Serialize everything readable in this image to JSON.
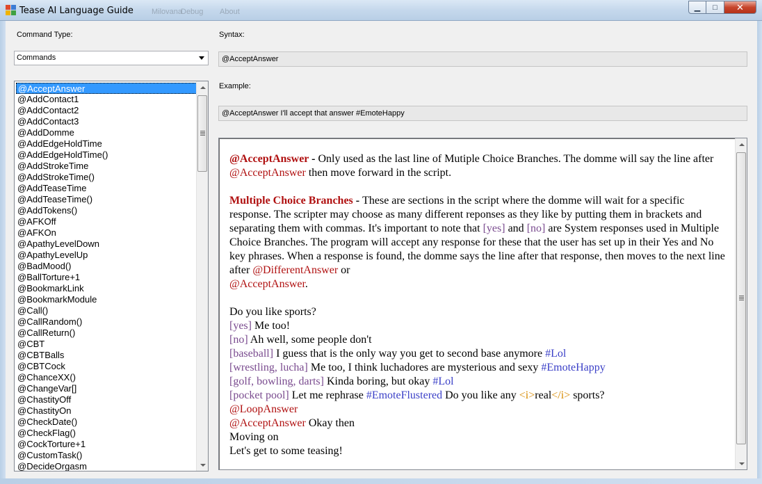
{
  "window": {
    "title": "Tease AI Language Guide",
    "ghost_menu": [
      "",
      "Milovana",
      "Debug",
      "About"
    ],
    "buttons": {
      "minimize": "▁",
      "maximize": "□",
      "close": "✕"
    }
  },
  "left_panel": {
    "command_type_label": "Command Type:",
    "command_type_value": "Commands",
    "commands": [
      "@AcceptAnswer",
      "@AddContact1",
      "@AddContact2",
      "@AddContact3",
      "@AddDomme",
      "@AddEdgeHoldTime",
      "@AddEdgeHoldTime()",
      "@AddStrokeTime",
      "@AddStrokeTime()",
      "@AddTeaseTime",
      "@AddTeaseTime()",
      "@AddTokens()",
      "@AFKOff",
      "@AFKOn",
      "@ApathyLevelDown",
      "@ApathyLevelUp",
      "@BadMood()",
      "@BallTorture+1",
      "@BookmarkLink",
      "@BookmarkModule",
      "@Call()",
      "@CallRandom()",
      "@CallReturn()",
      "@CBT",
      "@CBTBalls",
      "@CBTCock",
      "@ChanceXX()",
      "@ChangeVar[]",
      "@ChastityOff",
      "@ChastityOn",
      "@CheckDate()",
      "@CheckFlag()",
      "@CockTorture+1",
      "@CustomTask()",
      "@DecideOrgasm"
    ],
    "selected_index": 0
  },
  "right_panel": {
    "syntax_label": "Syntax:",
    "syntax_value": "@AcceptAnswer",
    "example_label": "Example:",
    "example_value": "@AcceptAnswer I'll accept that answer #EmoteHappy"
  },
  "description": {
    "p1": {
      "term": "@AcceptAnswer",
      "dash": " - ",
      "text_a": "Only used as the last line of Mutiple Choice Branches. The domme will say the line after ",
      "ref": "@AcceptAnswer",
      "text_b": " then move forward in the script."
    },
    "p2": {
      "term": "Multiple Choice Branches",
      "dash": " - ",
      "text_a": "These are sections in the script where the domme will wait for a specific response. The scripter may choose as many different reponses as they like by putting them in brackets and separating them with commas. It's important to note that ",
      "yes": "[yes]",
      "and": " and ",
      "no": "[no]",
      "text_b": " are System responses used in Multiple Choice Branches. The program will accept any response for these that the user has set up in their Yes and No key phrases. When a response is found, the domme says the line after that response, then moves to the next line after ",
      "ref1": "@DifferentAnswer",
      "or": " or",
      "ref2": "@AcceptAnswer",
      "end": "."
    },
    "example": {
      "q": "Do you like sports?",
      "l1_tag": "[yes]",
      "l1_text": " Me too!",
      "l2_tag": "[no]",
      "l2_text": " Ah well, some people don't",
      "l3_tag": "[baseball]",
      "l3_text": " I guess that is the only way you get to second base anymore ",
      "l3_emote": "#Lol",
      "l4_tag": "[wrestling, lucha]",
      "l4_text": " Me too, I think luchadores are mysterious and sexy ",
      "l4_emote": "#EmoteHappy",
      "l5_tag": "[golf, bowling, darts]",
      "l5_text": " Kinda boring, but okay ",
      "l5_emote": "#Lol",
      "l6_tag": "[pocket pool]",
      "l6_text": " Let me rephrase ",
      "l6_emote": "#EmoteFlustered",
      "l6_text2": " Do you like any ",
      "l6_i_open": "<i>",
      "l6_real": "real",
      "l6_i_close": "</i>",
      "l6_text3": " sports?",
      "l7": "@LoopAnswer",
      "l8_cmd": "@AcceptAnswer",
      "l8_text": " Okay then",
      "l9": "Moving on",
      "l10": "Let's get to some teasing!"
    }
  },
  "colors": {
    "command_red": "#b01010",
    "response_purple": "#7a4b8f",
    "emote_blue": "#3a3fc7",
    "tag_orange": "#d88a00",
    "selection": "#3399ff"
  }
}
